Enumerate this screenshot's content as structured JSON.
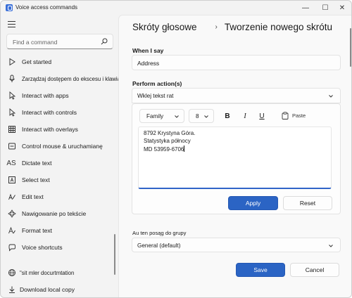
{
  "window": {
    "title": "Voice access commands",
    "controls": {
      "minimize": "—",
      "maximize": "☐",
      "close": "✕"
    }
  },
  "sidebar": {
    "search_placeholder": "Find a command",
    "items": [
      {
        "icon": "play-icon",
        "label": "Get started"
      },
      {
        "icon": "microphone-icon",
        "label": "Zarządzaj dostępem do ekscesu i klawiatury"
      },
      {
        "icon": "cursor-icon",
        "label": "Interact with apps"
      },
      {
        "icon": "cursor-icon",
        "label": "Interact with controls"
      },
      {
        "icon": "grid-icon",
        "label": "Interact with overlays"
      },
      {
        "icon": "mouse-icon",
        "label": "Control mouse & uruchamianę"
      },
      {
        "icon": "text-icon",
        "glyph": "AS",
        "label": "Dictate text"
      },
      {
        "icon": "select-text-icon",
        "label": "Select text"
      },
      {
        "icon": "edit-text-icon",
        "label": "Edit text"
      },
      {
        "icon": "navigate-icon",
        "label": "Nawigowanie po tekście"
      },
      {
        "icon": "format-text-icon",
        "label": "Format text"
      },
      {
        "icon": "voice-shortcut-icon",
        "label": "Voice shortcuts"
      }
    ],
    "footer": [
      {
        "icon": "globe-icon",
        "label": "\"sit mler docurtmtation"
      },
      {
        "icon": "download-icon",
        "label": "Download local copy"
      }
    ]
  },
  "main": {
    "breadcrumb": {
      "root": "Skróty głosowe",
      "separator": "›",
      "current": "Tworzenie nowego skrótu"
    },
    "when_i_say": {
      "label": "When I say",
      "value": "Address"
    },
    "perform_action": {
      "label": "Perform action(s)",
      "selected": "Wklej tekst rat"
    },
    "editor": {
      "font_family": "Family",
      "font_size": "8",
      "bold": "B",
      "italic": "I",
      "underline": "U",
      "paste_label": "Paste",
      "text_lines": [
        "8792 Krystyna Góra.",
        "Statystyka północy",
        "MD 53959-6706"
      ]
    },
    "apply_label": "Apply",
    "reset_label": "Reset",
    "group": {
      "label": "Au ten posąg do grupy",
      "selected": "General (default)"
    },
    "save_label": "Save",
    "cancel_label": "Cancel"
  }
}
